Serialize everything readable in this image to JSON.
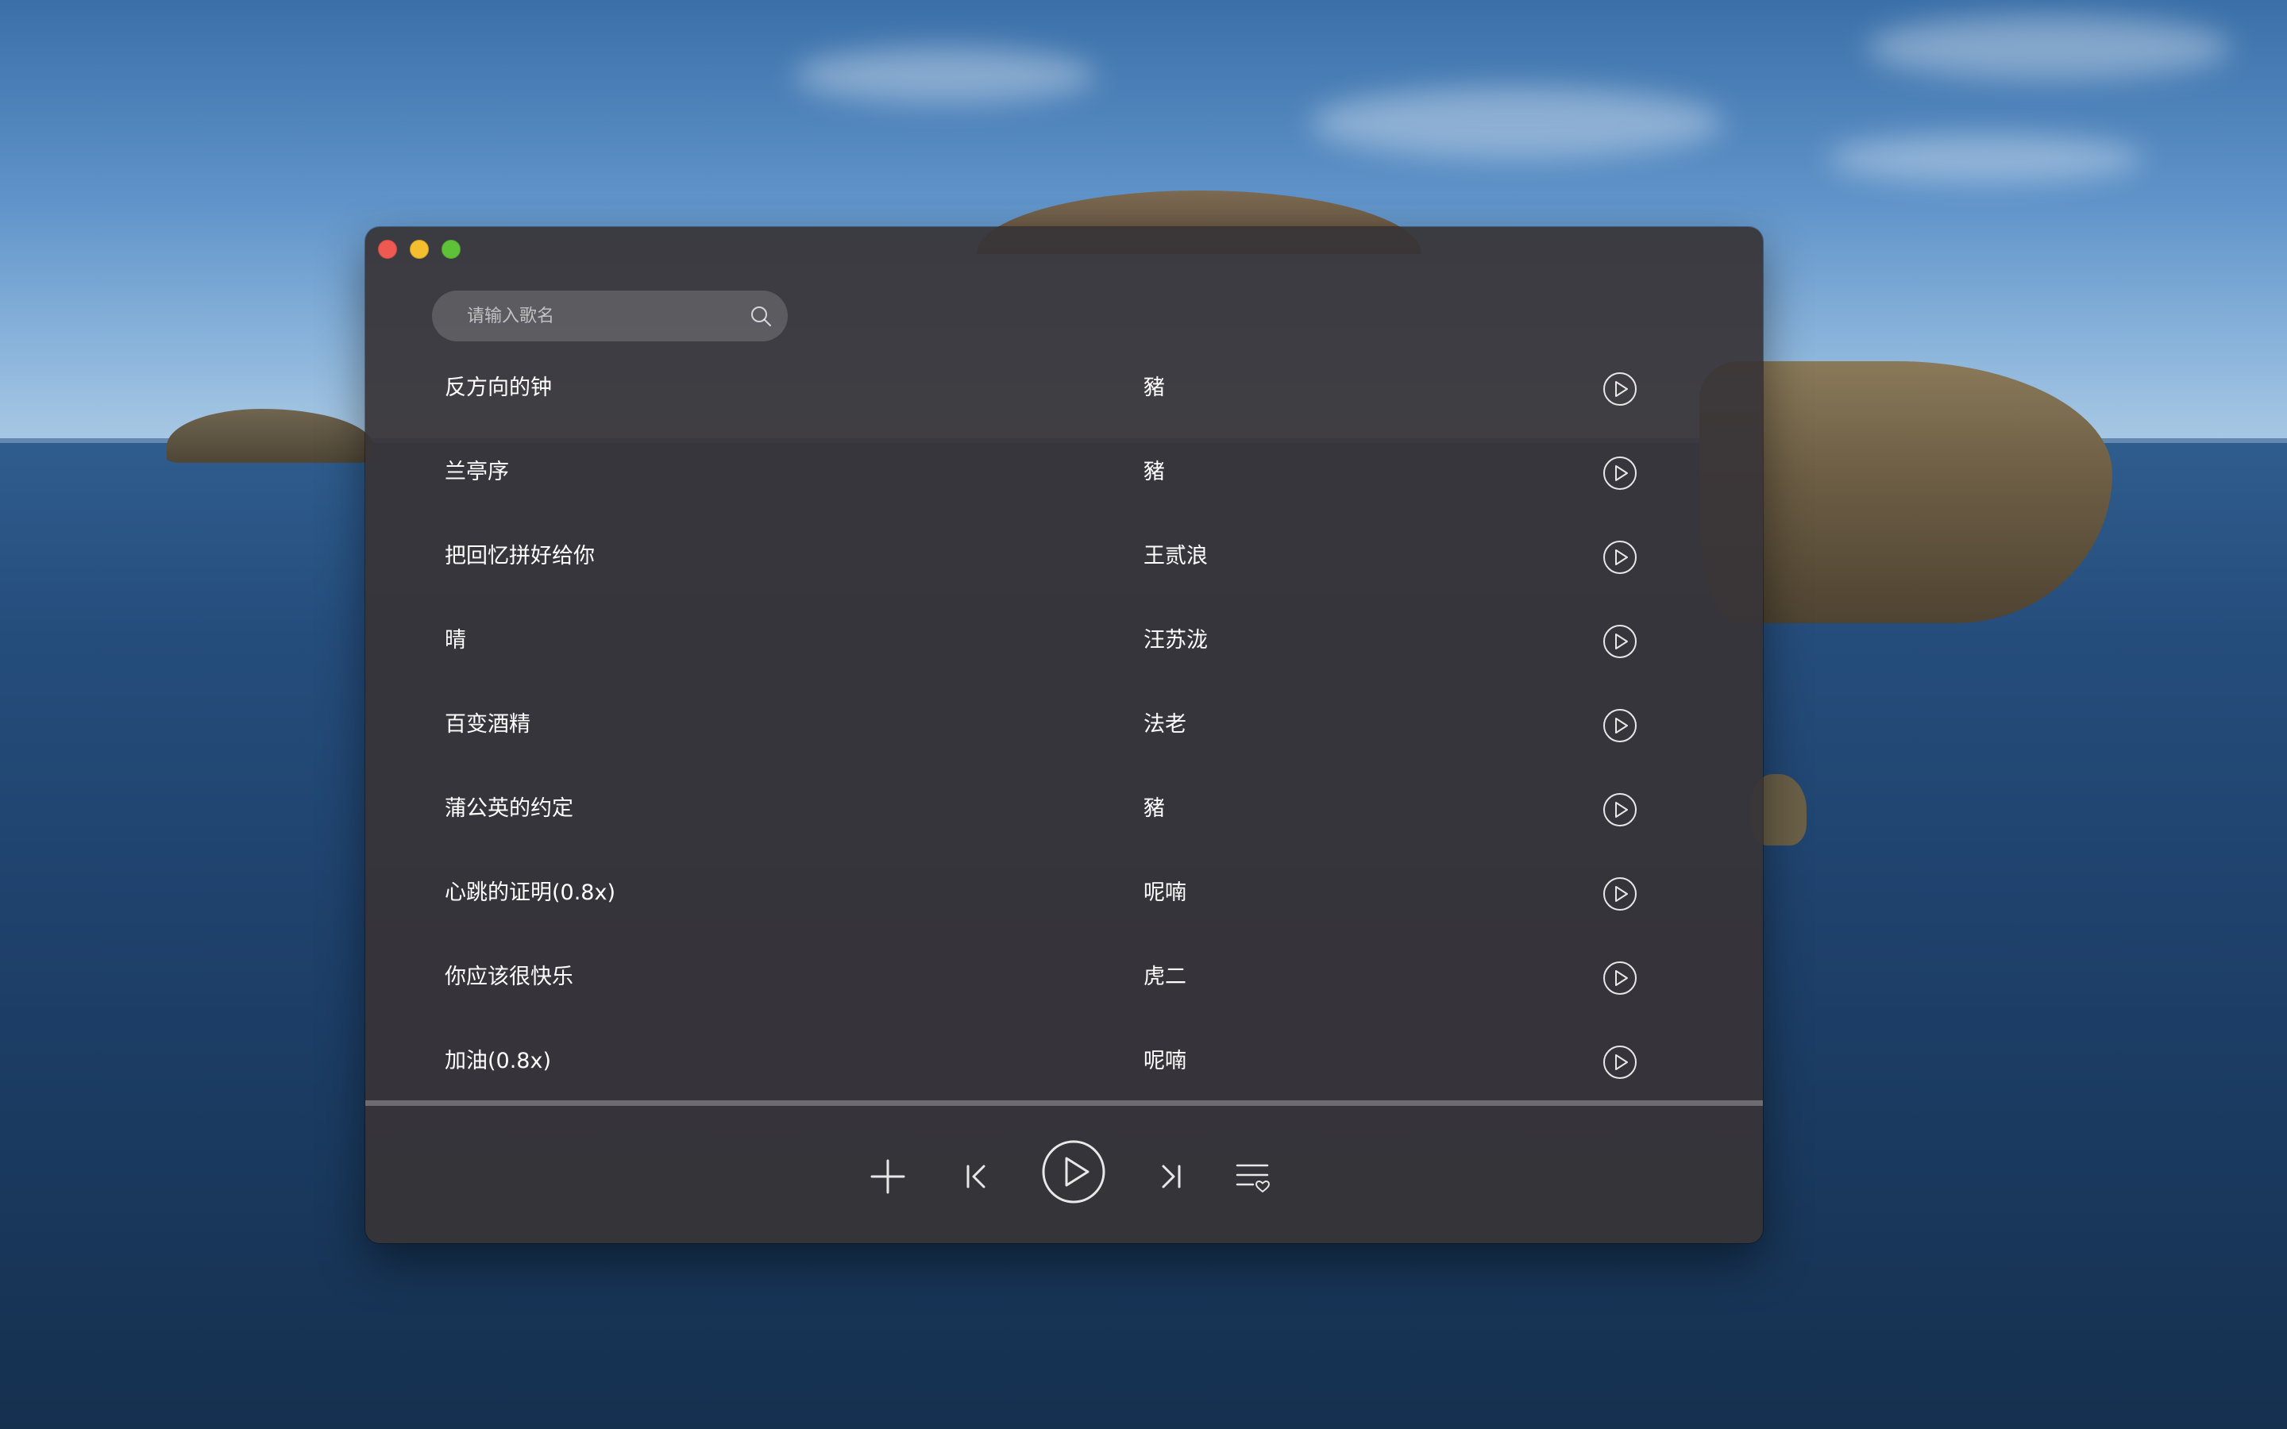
{
  "search": {
    "placeholder": "请输入歌名"
  },
  "songs": [
    {
      "title": "反方向的钟",
      "artist": "豬"
    },
    {
      "title": "兰亭序",
      "artist": "豬"
    },
    {
      "title": "把回忆拼好给你",
      "artist": "王贰浪"
    },
    {
      "title": "晴",
      "artist": "汪苏泷"
    },
    {
      "title": "百变酒精",
      "artist": "法老"
    },
    {
      "title": "蒲公英的约定",
      "artist": "豬"
    },
    {
      "title": "心跳的证明(0.8x)",
      "artist": "呢喃"
    },
    {
      "title": "你应该很快乐",
      "artist": "虎二"
    },
    {
      "title": "加油(0.8x)",
      "artist": "呢喃"
    }
  ],
  "player": {
    "progress": 0
  },
  "icons": {
    "search": "search-icon",
    "row_play": "play-circle-icon",
    "add": "plus-icon",
    "prev": "skip-previous-icon",
    "play": "play-circle-icon",
    "next": "skip-next-icon",
    "playlist": "playlist-heart-icon"
  },
  "colors": {
    "window_bg": "#383437",
    "text": "#ffffff",
    "close": "#ee5a52",
    "minimize": "#f5be2f",
    "maximize": "#5fc138"
  }
}
